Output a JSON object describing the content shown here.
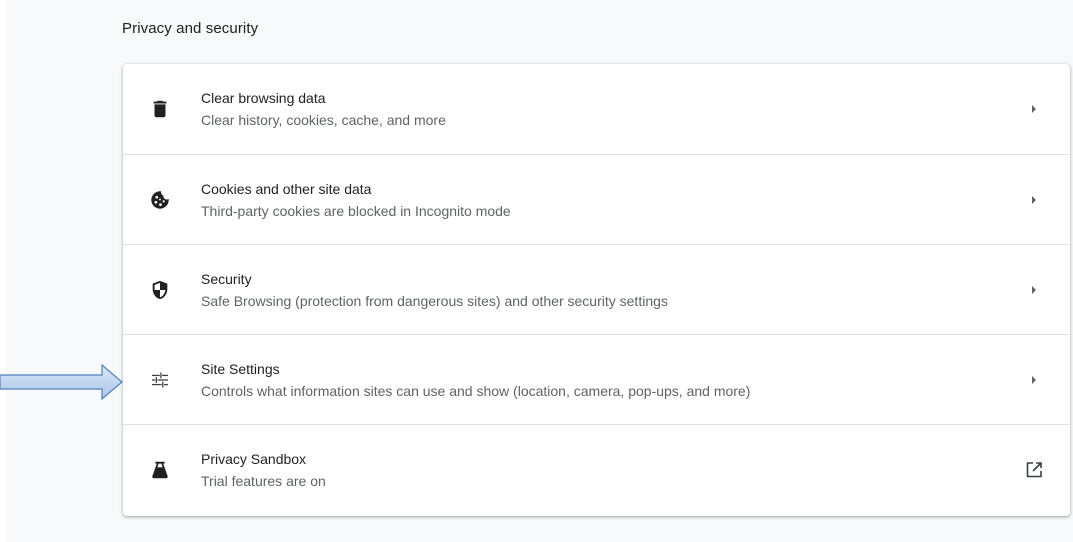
{
  "section": {
    "title": "Privacy and security"
  },
  "items": [
    {
      "label": "Clear browsing data",
      "sublabel": "Clear history, cookies, cache, and more",
      "icon": "trash-icon",
      "action_icon": "chevron-right-icon"
    },
    {
      "label": "Cookies and other site data",
      "sublabel": "Third-party cookies are blocked in Incognito mode",
      "icon": "cookie-icon",
      "action_icon": "chevron-right-icon"
    },
    {
      "label": "Security",
      "sublabel": "Safe Browsing (protection from dangerous sites) and other security settings",
      "icon": "shield-icon",
      "action_icon": "chevron-right-icon"
    },
    {
      "label": "Site Settings",
      "sublabel": "Controls what information sites can use and show (location, camera, pop-ups, and more)",
      "icon": "tune-icon",
      "action_icon": "chevron-right-icon"
    },
    {
      "label": "Privacy Sandbox",
      "sublabel": "Trial features are on",
      "icon": "flask-icon",
      "action_icon": "open-in-new-icon"
    }
  ],
  "annotation": {
    "icon": "pointer-arrow-icon",
    "color": "#4f81bd",
    "fill_light": "#dbe8f7"
  },
  "colors": {
    "icon": "#202124",
    "chevron": "#5f6368",
    "divider": "#e0e0e0"
  }
}
